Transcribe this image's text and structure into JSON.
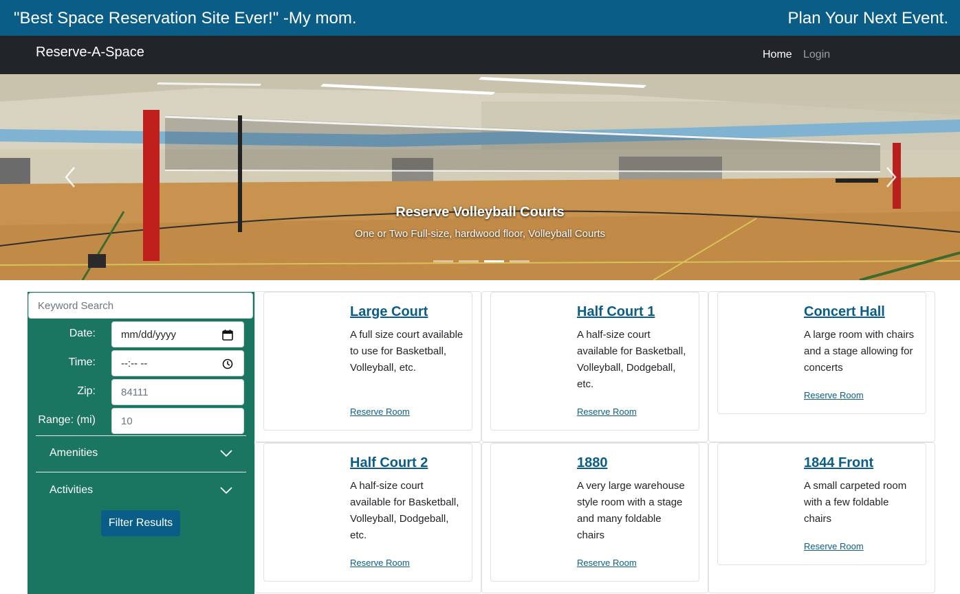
{
  "banner": {
    "quote": "\"Best Space Reservation Site Ever!\" -My mom.",
    "tagline": "Plan Your Next Event."
  },
  "navbar": {
    "brand": "Reserve-A-Space",
    "links": [
      {
        "label": "Home",
        "active": true
      },
      {
        "label": "Login",
        "active": false
      }
    ]
  },
  "carousel": {
    "caption_title": "Reserve Volleyball Courts",
    "caption_text": "One or Two Full-size, hardwood floor, Volleyball Courts",
    "slide_count": 4,
    "active_slide": 3
  },
  "filters": {
    "keyword_placeholder": "Keyword Search",
    "date_label": "Date:",
    "date_value": "mm/dd/yyyy",
    "time_label": "Time:",
    "time_value": "--:-- --",
    "zip_label": "Zip:",
    "zip_placeholder": "84111",
    "range_label": "Range: (mi)",
    "range_placeholder": "10",
    "amenities_label": "Amenities",
    "activities_label": "Activities",
    "filter_button": "Filter Results"
  },
  "rooms": [
    {
      "title": "Large Court",
      "description": "A full size court available to use for Basketball, Volleyball, etc.",
      "action": "Reserve Room"
    },
    {
      "title": "Half Court 1",
      "description": "A half-size court available for Basketball, Volleyball, Dodgeball, etc.",
      "action": "Reserve Room"
    },
    {
      "title": "Concert Hall",
      "description": "A large room with chairs and a stage allowing for concerts",
      "action": "Reserve Room"
    },
    {
      "title": "Half Court 2",
      "description": "A half-size court available for Basketball, Volleyball, Dodgeball, etc.",
      "action": "Reserve Room"
    },
    {
      "title": "1880",
      "description": "A very large warehouse style room with a stage and many foldable chairs",
      "action": "Reserve Room"
    },
    {
      "title": "1844 Front",
      "description": "A small carpeted room with a few foldable chairs",
      "action": "Reserve Room"
    }
  ],
  "colors": {
    "banner_bg": "#095d87",
    "navbar_bg": "#212529",
    "sidebar_bg": "#1a7561",
    "link": "#095d87"
  },
  "icons": {
    "date": "calendar-icon",
    "time": "clock-icon",
    "accordion": "chevron-down-icon",
    "carousel_prev": "chevron-left-icon",
    "carousel_next": "chevron-right-icon"
  }
}
